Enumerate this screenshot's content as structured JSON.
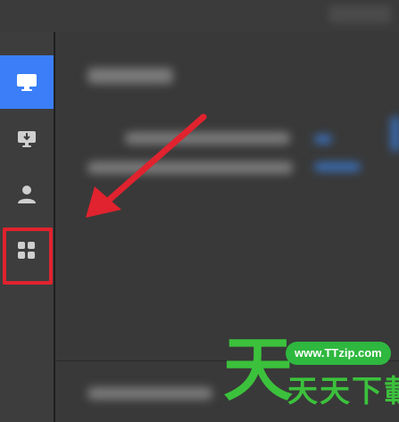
{
  "sidebar": {
    "items": [
      {
        "icon": "monitor-icon",
        "active": true
      },
      {
        "icon": "download-monitor-icon",
        "active": false
      },
      {
        "icon": "user-icon",
        "active": false
      },
      {
        "icon": "apps-grid-icon",
        "active": false,
        "highlighted": true
      }
    ]
  },
  "colors": {
    "accent": "#3b7ef7",
    "highlight": "#e0232e",
    "watermark": "#3cc13c"
  },
  "watermark": {
    "url": "www.TTzip.com",
    "big_char": "天",
    "small_text": "天天下載"
  }
}
